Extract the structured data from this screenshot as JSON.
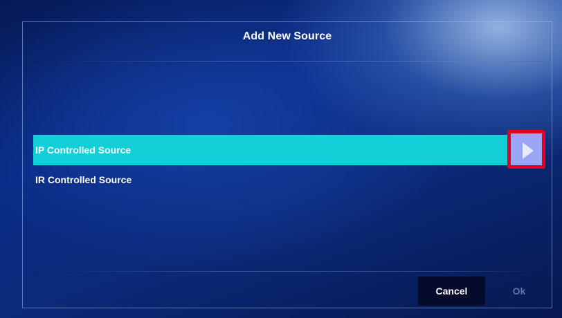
{
  "dialog": {
    "title": "Add New Source"
  },
  "sources": {
    "items": [
      {
        "label": "IP Controlled Source",
        "selected": true
      },
      {
        "label": "IR Controlled Source",
        "selected": false
      }
    ],
    "arrow_icon": "play-arrow-icon"
  },
  "footer": {
    "cancel_label": "Cancel",
    "ok_label": "Ok"
  },
  "colors": {
    "selected_row": "#12cfd8",
    "highlight_border": "#e4001d",
    "arrow_button": "#9aa6f5"
  }
}
